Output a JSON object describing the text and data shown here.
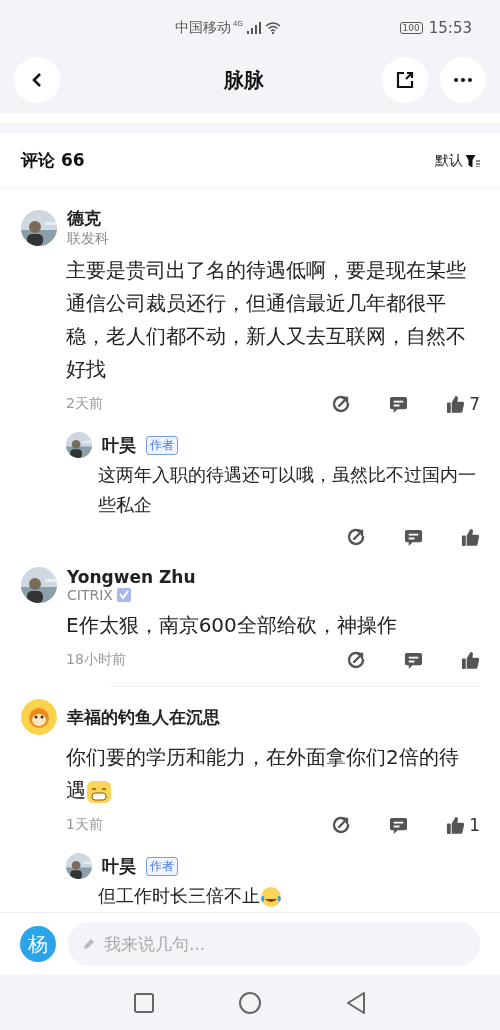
{
  "status_bar": {
    "carrier": "中国移动",
    "network": "4G",
    "battery": "100",
    "time": "15:53"
  },
  "header": {
    "title": "脉脉"
  },
  "comments_header": {
    "title": "评论 66",
    "sort": "默认"
  },
  "comments": [
    {
      "name": "德克",
      "company": "联发科",
      "text": "主要是贵司出了名的待遇低啊，要是现在某些通信公司裁员还行，但通信最近几年都很平稳，老人们都不动，新人又去互联网，自然不好找",
      "time": "2天前",
      "likes": "7",
      "replies": [
        {
          "name": "叶昊",
          "badge": "作者",
          "text": "这两年入职的待遇还可以哦，虽然比不过国内一些私企"
        }
      ]
    },
    {
      "name": "Yongwen Zhu",
      "company": "CITRIX",
      "verified": true,
      "text": "E作太狠，南京600全部给砍，神操作",
      "time": "18小时前"
    },
    {
      "avatar": {
        "kind": "monkey"
      },
      "name": "幸福的钓鱼人在沉思",
      "text": "你们要的学历和能力，在外面拿你们2倍的待遇",
      "emoji": {
        "kind": "grin"
      },
      "time": "1天前",
      "likes": "1",
      "replies": [
        {
          "name": "叶昊",
          "badge": "作者",
          "text": "但工作时长三倍不止",
          "emoji": {
            "kind": "tears"
          }
        }
      ]
    }
  ],
  "input": {
    "avatar_text": "杨",
    "placeholder": "我来说几句..."
  }
}
